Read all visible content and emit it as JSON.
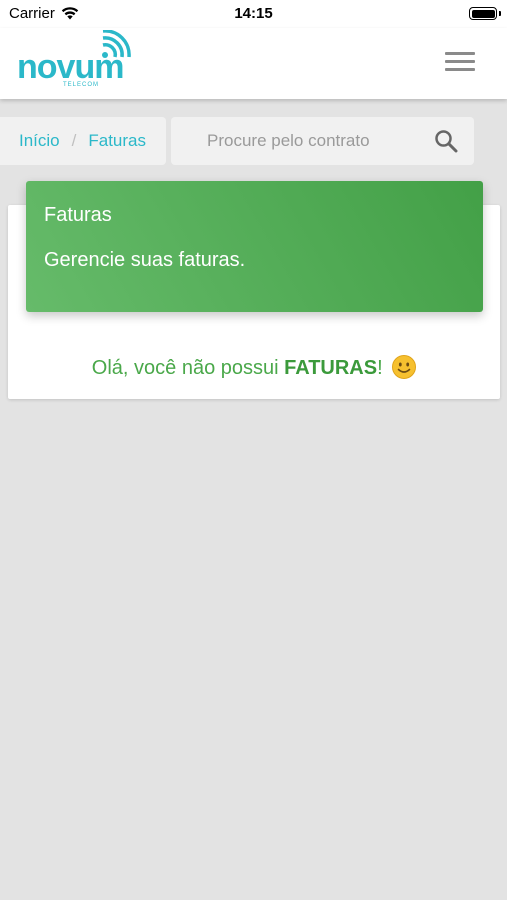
{
  "status_bar": {
    "carrier": "Carrier",
    "time": "14:15"
  },
  "header": {
    "logo_text": "novum",
    "logo_subtext": "TELECOM"
  },
  "breadcrumb": {
    "items": [
      "Início",
      "Faturas"
    ],
    "separator": "/"
  },
  "search": {
    "placeholder": "Procure pelo contrato",
    "value": ""
  },
  "banner": {
    "title": "Faturas",
    "subtitle": "Gerencie suas faturas."
  },
  "message": {
    "prefix": "Olá, você não possui ",
    "emphasis": "FATURAS",
    "suffix": "!"
  },
  "colors": {
    "accent": "#2bb8c9",
    "success": "#4caf50",
    "background": "#e3e3e3"
  }
}
